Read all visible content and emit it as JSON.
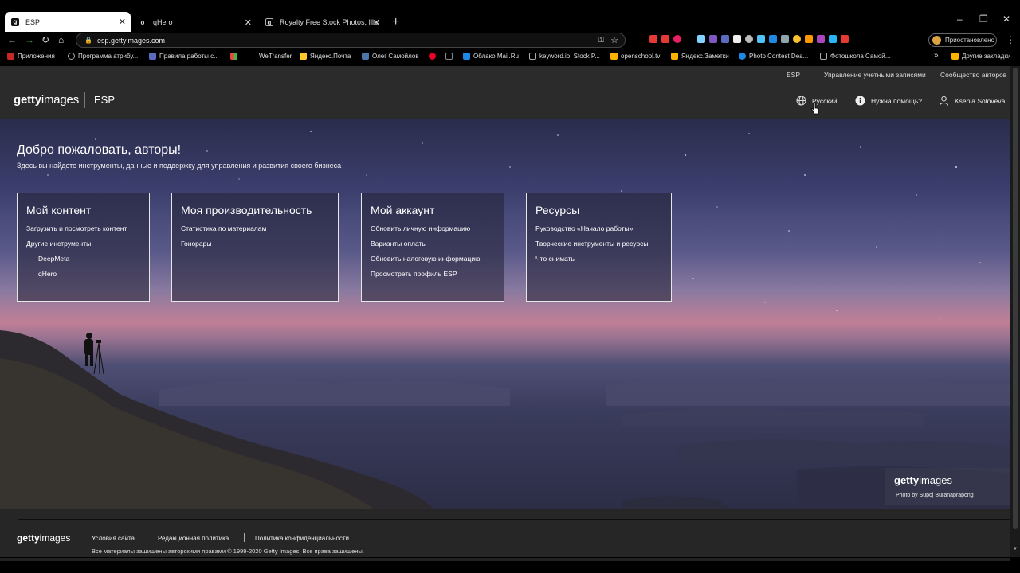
{
  "browser": {
    "tabs": [
      {
        "title": "ESP",
        "active": true,
        "favicon": "getty-g-icon"
      },
      {
        "title": "qHero",
        "active": false,
        "favicon": "qhero-icon"
      },
      {
        "title": "Royalty Free Stock Photos, Illustr",
        "active": false,
        "favicon": "getty-g-icon"
      }
    ],
    "url": "esp.gettyimages.com",
    "profile_status": "Приостановлено",
    "bookmarks": [
      "Приложения",
      "Программа атрибу...",
      "Правила работы с...",
      "WeTransfer",
      "Яндекс.Почта",
      "Олег Самойлов",
      "Облако Mail.Ru",
      "keyword.io: Stock P...",
      "openschool.tv",
      "Яндекс.Заметки",
      "Photo Contest Dea...",
      "Фотошкола Самой...",
      "Другие закладки"
    ]
  },
  "topnav": {
    "esp": "ESP",
    "accounts": "Управление учетными записями",
    "community": "Сообщество авторов"
  },
  "header": {
    "logo_bold": "getty",
    "logo_light": "images",
    "section": "ESP",
    "language": "Русский",
    "help": "Нужна помощь?",
    "user": "Ksenia Soloveva"
  },
  "hero": {
    "title": "Добро пожаловать, авторы!",
    "subtitle": "Здесь вы найдете инструменты, данные и поддержку для управления и развития своего бизнеса"
  },
  "cards": [
    {
      "title": "Мой контент",
      "links": [
        {
          "text": "Загрузить и посмотреть контент",
          "indent": false
        },
        {
          "text": "Другие инструменты",
          "indent": false
        },
        {
          "text": "DeepMeta",
          "indent": true
        },
        {
          "text": "qHero",
          "indent": true
        }
      ]
    },
    {
      "title": "Моя производительность",
      "links": [
        {
          "text": "Статистика по материалам",
          "indent": false
        },
        {
          "text": "Гонорары",
          "indent": false
        }
      ]
    },
    {
      "title": "Мой аккаунт",
      "links": [
        {
          "text": "Обновить личную информацию",
          "indent": false
        },
        {
          "text": "Варианты оплаты",
          "indent": false
        },
        {
          "text": "Обновить налоговую информацию",
          "indent": false
        },
        {
          "text": "Просмотреть профиль ESP",
          "indent": false
        }
      ]
    },
    {
      "title": "Ресурсы",
      "links": [
        {
          "text": "Руководство «Начало работы»",
          "indent": false
        },
        {
          "text": "Творческие инструменты и ресурсы",
          "indent": false
        },
        {
          "text": "Что снимать",
          "indent": false
        }
      ]
    }
  ],
  "watermark": {
    "logo_bold": "getty",
    "logo_light": "images",
    "credit": "Photo by Supoj Buranaprapong"
  },
  "footer": {
    "logo_bold": "getty",
    "logo_light": "images",
    "links": [
      "Условия сайта",
      "Редакционная политика",
      "Политика конфиденциальности"
    ],
    "copyright": "Все материалы защищены авторскими правами © 1999-2020 Getty Images. Все права защищены."
  },
  "colors": {
    "page_bg": "#222222",
    "header_bg": "#2b2b2b",
    "card_border": "#e6e6e6"
  }
}
